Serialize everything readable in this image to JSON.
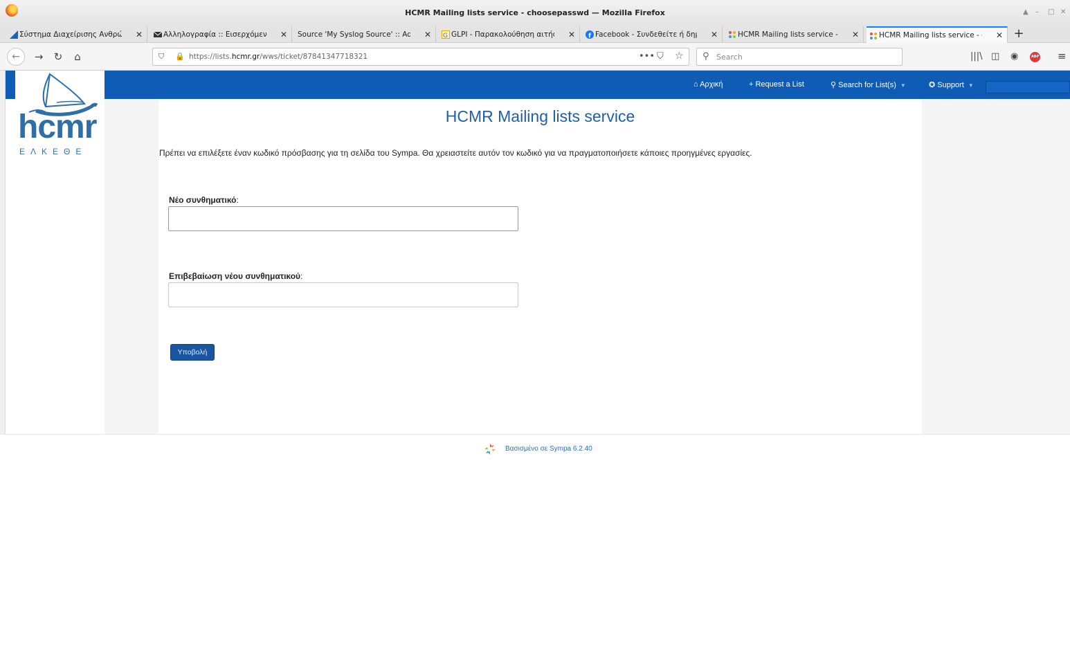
{
  "window": {
    "title": "HCMR Mailing lists service - choosepasswd — Mozilla Firefox",
    "controls": [
      "▲",
      "–",
      "□",
      "✕"
    ]
  },
  "tabs": [
    {
      "label": "Σύστημα Διαχείρισης Ανθρώπ",
      "icon": "blue-flag-icon",
      "active": false
    },
    {
      "label": "Αλληλογραφία :: Εισερχόμενα",
      "icon": "mail-icon",
      "active": false
    },
    {
      "label": "Source 'My Syslog Source' :: Adis",
      "icon": "none",
      "active": false
    },
    {
      "label": "GLPI - Παρακολούθηση αιτήσ",
      "icon": "glpi-icon",
      "active": false
    },
    {
      "label": "Facebook - Συνδεθείτε ή δημ",
      "icon": "facebook-icon",
      "active": false
    },
    {
      "label": "HCMR Mailing lists service - n",
      "icon": "sympa-icon",
      "active": false
    },
    {
      "label": "HCMR Mailing lists service - c",
      "icon": "sympa-icon",
      "active": true
    }
  ],
  "newtab_label": "+",
  "navbar": {
    "url_prefix": "https://lists.",
    "url_domain": "hcmr.gr",
    "url_path": "/wws/ticket/87841347718321",
    "search_placeholder": "Search",
    "more": "•••",
    "abp": "ABP"
  },
  "site_nav": {
    "home": "Αρχική",
    "request": "Request a List",
    "search": "Search for List(s)",
    "support": "Support"
  },
  "logo": {
    "text": "hcmr",
    "greek": "ΕΛΚΕΘΕ"
  },
  "page": {
    "heading": "HCMR Mailing lists service",
    "intro_a": "Πρέπει να επιλέξετε έναν κωδικό πρόσβασης για τη σελίδα του ",
    "intro_sympa": "Sympa",
    "intro_b": ". Θα χρειαστείτε αυτόν τον κωδικό για να πραγματοποιήσετε κάποιες προηγμένες εργασίες.",
    "new_password_label": "Νέο συνθηματικό",
    "confirm_password_label": "Επιβεβαίωση νέου συνθηματικού",
    "colon": ":",
    "new_password_value": "",
    "confirm_password_value": "",
    "submit_label": "Υποβολή"
  },
  "footer": {
    "powered": "Βασισμένο σε ",
    "link": "Sympa 6.2.40"
  },
  "colors": {
    "nav_bg": "#0f5cb5",
    "heading": "#1f5ea8",
    "button": "#1a56a0"
  }
}
